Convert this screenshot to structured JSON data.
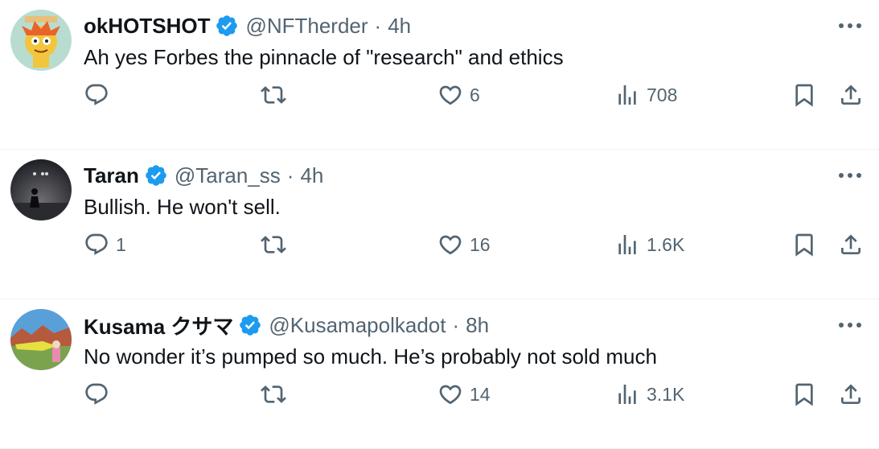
{
  "colors": {
    "text": "#0f1419",
    "muted": "#536471",
    "verified": "#1d9bf0",
    "divider": "#eff3f4"
  },
  "icons": [
    "reply-icon",
    "retweet-icon",
    "like-icon",
    "views-icon",
    "bookmark-icon",
    "share-icon",
    "verified-icon",
    "more-icon"
  ],
  "tweets": [
    {
      "name": "okHOTSHOT",
      "handle": "@NFTherder",
      "dot": "·",
      "time": "4h",
      "text": "Ah yes Forbes the pinnacle of \"research\" and ethics",
      "replies": "",
      "retweets": "",
      "likes": "6",
      "views": "708"
    },
    {
      "name": "Taran",
      "handle": "@Taran_ss",
      "dot": "·",
      "time": "4h",
      "text": "Bullish. He won't sell.",
      "replies": "1",
      "retweets": "",
      "likes": "16",
      "views": "1.6K"
    },
    {
      "name": "Kusama クサマ",
      "handle": "@Kusamapolkadot",
      "dot": "·",
      "time": "8h",
      "text": "No wonder it’s pumped so much. He’s probably not sold much",
      "replies": "",
      "retweets": "",
      "likes": "14",
      "views": "3.1K"
    }
  ]
}
